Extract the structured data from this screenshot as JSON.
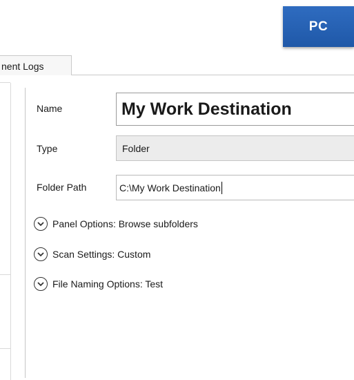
{
  "badge": {
    "label": "PC",
    "color": "#2a64b8"
  },
  "tabs": [
    {
      "label": "nent Logs"
    }
  ],
  "form": {
    "name": {
      "label": "Name",
      "value": "My Work Destination"
    },
    "type": {
      "label": "Type",
      "value": "Folder"
    },
    "folder_path": {
      "label": "Folder Path",
      "value": "C:\\My Work Destination"
    }
  },
  "sections": [
    {
      "label": "Panel Options: Browse subfolders",
      "icon": "chevron-down-circle-icon"
    },
    {
      "label": "Scan Settings: Custom",
      "icon": "chevron-down-circle-icon"
    },
    {
      "label": "File Naming Options: Test",
      "icon": "chevron-down-circle-icon"
    }
  ]
}
